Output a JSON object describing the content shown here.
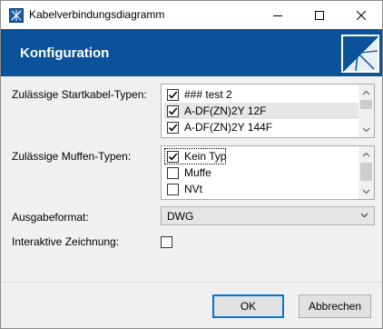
{
  "window": {
    "title": "Kabelverbindungsdiagramm",
    "icon": "network-diagram-icon",
    "controls": [
      "minimize-icon",
      "maximize-icon",
      "close-icon"
    ]
  },
  "header": {
    "title": "Konfiguration",
    "background_color": "#0a5299",
    "logo": "company-logo"
  },
  "form": {
    "startkabel": {
      "label": "Zulässige Startkabel-Typen:",
      "items": [
        {
          "label": "### test 2",
          "checked": true
        },
        {
          "label": "A-DF(ZN)2Y 12F",
          "checked": true,
          "selected": true
        },
        {
          "label": "A-DF(ZN)2Y 144F",
          "checked": true
        }
      ]
    },
    "muffen": {
      "label": "Zulässige Muffen-Typen:",
      "items": [
        {
          "label": "Kein Typ",
          "checked": true,
          "focused": true
        },
        {
          "label": "Muffe",
          "checked": false
        },
        {
          "label": "NVt",
          "checked": false
        }
      ]
    },
    "ausgabeformat": {
      "label": "Ausgabeformat:",
      "value": "DWG"
    },
    "interaktiv": {
      "label": "Interaktive Zeichnung:",
      "checked": false
    }
  },
  "buttons": {
    "ok": "OK",
    "cancel": "Abbrechen"
  }
}
